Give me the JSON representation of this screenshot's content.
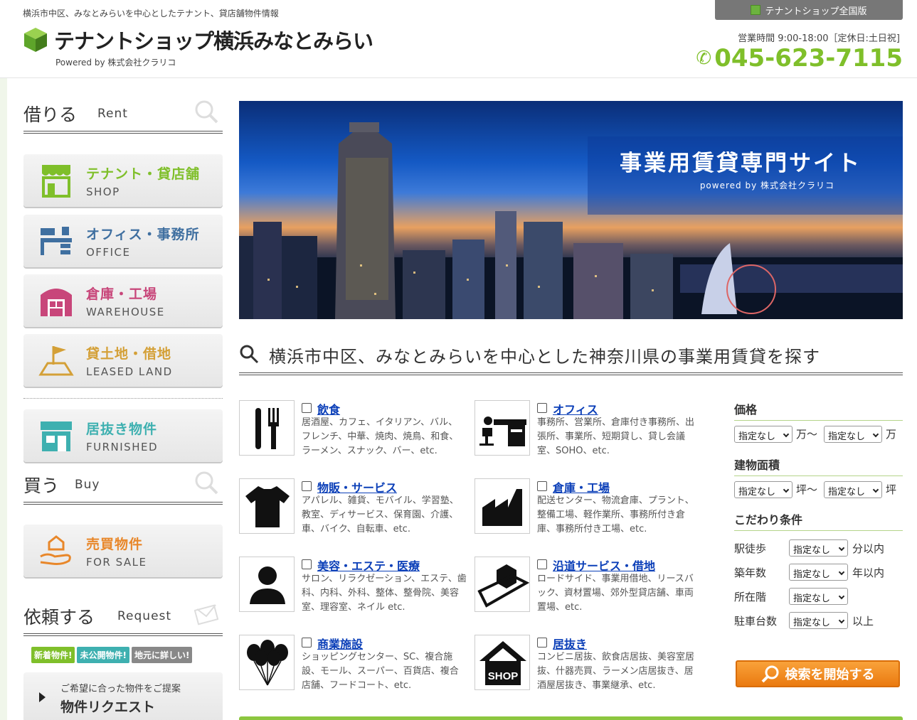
{
  "header": {
    "tagline": "横浜市中区、みなとみらいを中心としたテナント、貸店舗物件情報",
    "site_name": "テナントショップ横浜みなとみらい",
    "powered_by": "Powered by 株式会社クラリコ",
    "nationwide_link": "テナントショップ全国版",
    "hours": "営業時間 9:00-18:00［定休日:土日祝]",
    "phone": "045-623-7115"
  },
  "sidebar": {
    "rent": {
      "jp": "借りる",
      "en": "Rent"
    },
    "rent_items": [
      {
        "jp": "テナント・貸店舗",
        "en": "SHOP",
        "color": "#7fbf2a"
      },
      {
        "jp": "オフィス・事務所",
        "en": "OFFICE",
        "color": "#3f6fa0"
      },
      {
        "jp": "倉庫・工場",
        "en": "WAREHOUSE",
        "color": "#c8467a"
      },
      {
        "jp": "貸土地・借地",
        "en": "LEASED LAND",
        "color": "#d4a037"
      },
      {
        "jp": "居抜き物件",
        "en": "FURNISHED",
        "color": "#3eb0b0"
      }
    ],
    "buy": {
      "jp": "買う",
      "en": "Buy"
    },
    "buy_items": [
      {
        "jp": "売買物件",
        "en": "FOR SALE",
        "color": "#e8872a"
      }
    ],
    "request": {
      "jp": "依頼する",
      "en": "Request"
    },
    "badges": [
      "新着物件!",
      "未公開物件!",
      "地元に詳しい!"
    ],
    "request_button": {
      "sub": "ご希望に合った物件をご提案",
      "main": "物件リクエスト"
    }
  },
  "hero": {
    "title": "事業用賃貸専門サイト",
    "subtitle": "powered by 株式会社クラリコ"
  },
  "search_heading": "横浜市中区、みなとみらいを中心とした神奈川県の事業用賃貸を探す",
  "categories": [
    {
      "name": "飲食",
      "desc": "居酒屋、カフェ、イタリアン、バル、フレンチ、中華、焼肉、焼鳥、和食、ラーメン、スナック、バー、etc.",
      "icon": "fork-knife-icon"
    },
    {
      "name": "オフィス",
      "desc": "事務所、営業所、倉庫付き事務所、出張所、事業所、短期貸し、貸し会議室、SOHO、etc.",
      "icon": "office-desk-icon"
    },
    {
      "name": "物販・サービス",
      "desc": "アパレル、雑貨、モバイル、学習塾、教室、ディサービス、保育園、介護、車、バイク、自転車、etc.",
      "icon": "tshirt-icon"
    },
    {
      "name": "倉庫・工場",
      "desc": "配送センター、物流倉庫、プラント、整備工場、軽作業所、事務所付き倉庫、事務所付き工場、etc.",
      "icon": "factory-icon"
    },
    {
      "name": "美容・エステ・医療",
      "desc": "サロン、リラクゼーション、エステ、歯科、内科、外科、整体、整骨院、美容室、理容室、ネイル etc.",
      "icon": "person-icon"
    },
    {
      "name": "沿道サービス・借地",
      "desc": "ロードサイド、事業用借地、リースバック、資材置場、郊外型貸店舗、車両置場、etc.",
      "icon": "roadside-icon"
    },
    {
      "name": "商業施設",
      "desc": "ショッピングセンター、SC、複合施設、モール、スーパー、百貨店、複合店舗、フードコート、etc.",
      "icon": "balloons-icon"
    },
    {
      "name": "居抜き",
      "desc": "コンビニ居抜、飲食店居抜、美容室居抜、什器売買、ラーメン店居抜き、居酒屋居抜き、事業継承、etc.",
      "icon": "shop-house-icon",
      "icon_label": "SHOP"
    }
  ],
  "filters": {
    "price": {
      "label": "価格",
      "from": "指定なし",
      "to": "指定なし",
      "unit": "万",
      "tilde": "〜"
    },
    "area": {
      "label": "建物面積",
      "from": "指定なし",
      "to": "指定なし",
      "unit": "坪",
      "tilde": "〜"
    },
    "conditions": {
      "label": "こだわり条件",
      "rows": [
        {
          "label": "駅徒歩",
          "value": "指定なし",
          "suffix": "分以内"
        },
        {
          "label": "築年数",
          "value": "指定なし",
          "suffix": "年以内"
        },
        {
          "label": "所在階",
          "value": "指定なし",
          "suffix": ""
        },
        {
          "label": "駐車台数",
          "value": "指定なし",
          "suffix": "以上"
        }
      ]
    },
    "search_button": "検索を開始する"
  }
}
